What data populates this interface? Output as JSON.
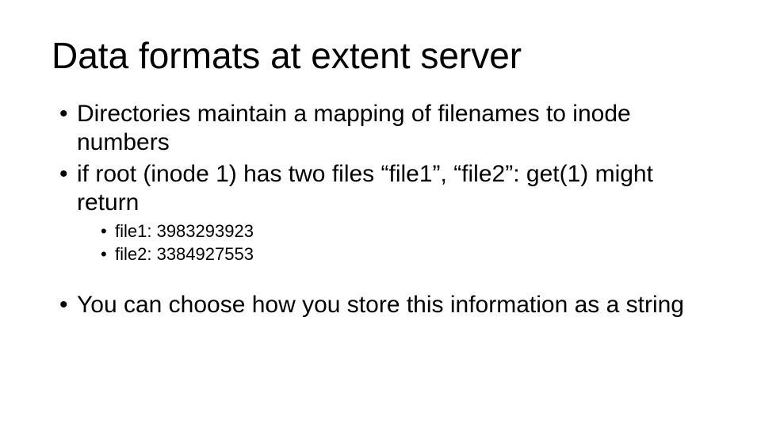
{
  "slide": {
    "title": "Data formats at extent server",
    "bullets": {
      "b1": "Directories maintain a mapping of filenames to inode numbers",
      "b2": "if root (inode 1) has two files “file1”, “file2”: get(1) might return",
      "b2_sub1": "file1: 3983293923",
      "b2_sub2": "file2: 3384927553",
      "b3": "You can choose how you store this information as a string"
    }
  }
}
